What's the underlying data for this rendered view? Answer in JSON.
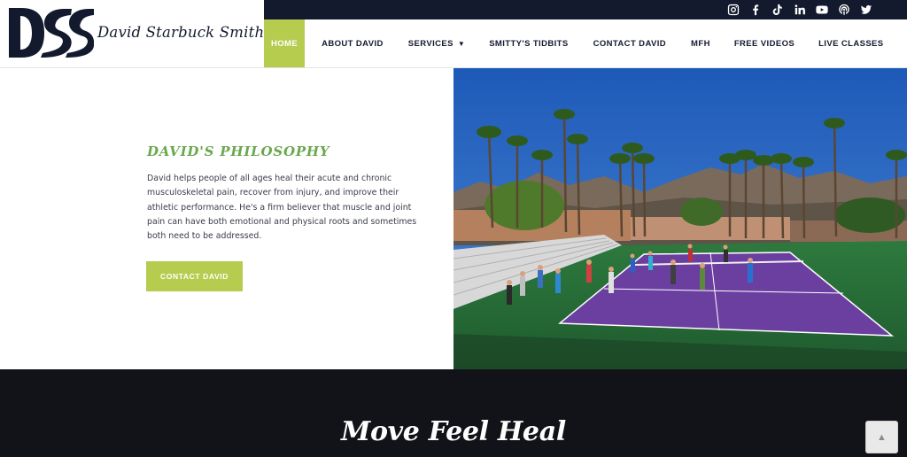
{
  "brand": {
    "name": "David Starbuck Smith",
    "monogram": "DSS",
    "color_navy": "#141a2e",
    "color_accent": "#b6cc4f",
    "color_green_heading": "#6aa84f"
  },
  "socials": [
    {
      "icon": "instagram-icon"
    },
    {
      "icon": "facebook-icon"
    },
    {
      "icon": "tiktok-icon"
    },
    {
      "icon": "linkedin-icon"
    },
    {
      "icon": "youtube-icon"
    },
    {
      "icon": "podcast-icon"
    },
    {
      "icon": "twitter-icon"
    }
  ],
  "nav": {
    "home": "HOME",
    "about": "ABOUT DAVID",
    "services": "SERVICES",
    "tidbits": "SMITTY'S TIDBITS",
    "contact": "CONTACT DAVID",
    "mfh": "MFH",
    "videos": "FREE VIDEOS",
    "classes": "LIVE CLASSES"
  },
  "philosophy": {
    "title": "DAVID'S PHILOSOPHY",
    "body": "David helps people of all ages heal their acute and chronic musculoskeletal pain, recover from injury, and improve their athletic performance. He's a firm believer that muscle and joint pain can have both emotional and physical roots and sometimes both need to be addressed.",
    "cta": "CONTACT DAVID"
  },
  "band": {
    "title": "Move Feel Heal"
  },
  "scroll_top": {
    "icon": "chevron-up-icon",
    "glyph": "▲"
  }
}
